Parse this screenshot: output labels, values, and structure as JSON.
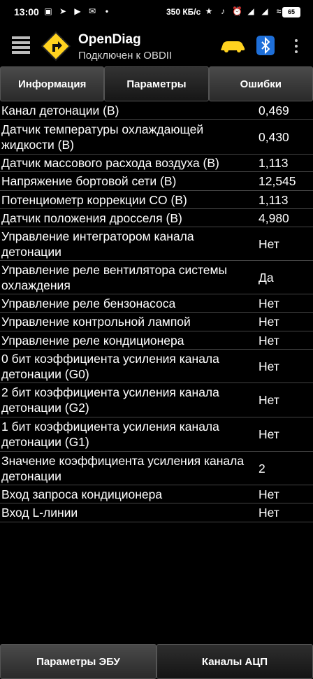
{
  "status_bar": {
    "time": "13:00",
    "speed": "350 КБ/с",
    "battery": "65",
    "left_icons": [
      "screenshot-icon",
      "telegram-icon",
      "video-icon",
      "mail-icon",
      "dot-icon"
    ],
    "right_icons": [
      "bluetooth-icon",
      "mute-icon",
      "alarm-icon",
      "signal-icon",
      "signal-icon",
      "wifi-icon"
    ]
  },
  "app_bar": {
    "title": "OpenDiag",
    "subtitle": "Подключен к OBDII",
    "car_color": "#ffd21f",
    "bt_color": "#1e6fd9"
  },
  "tabs": [
    {
      "label": "Информация"
    },
    {
      "label": "Параметры"
    },
    {
      "label": "Ошибки"
    }
  ],
  "active_tab": "Параметры",
  "params": [
    {
      "name": "Канал детонации (В)",
      "value": "0,469"
    },
    {
      "name": "Датчик температуры охлаждающей жидкости (В)",
      "value": "0,430"
    },
    {
      "name": "Датчик массового расхода воздуха (В)",
      "value": "1,113"
    },
    {
      "name": "Напряжение бортовой сети (В)",
      "value": "12,545"
    },
    {
      "name": "Потенциометр коррекции CO (В)",
      "value": "1,113"
    },
    {
      "name": "Датчик положения дросселя (В)",
      "value": "4,980"
    },
    {
      "name": "Управление интегратором канала детонации",
      "value": "Нет"
    },
    {
      "name": "Управление реле вентилятора системы охлаждения",
      "value": "Да"
    },
    {
      "name": "Управление реле бензонасоса",
      "value": "Нет"
    },
    {
      "name": "Управление контрольной лампой",
      "value": "Нет"
    },
    {
      "name": "Управление реле кондиционера",
      "value": "Нет"
    },
    {
      "name": "0 бит коэффициента усиления канала детонации (G0)",
      "value": "Нет"
    },
    {
      "name": "2 бит коэффициента усиления канала детонации (G2)",
      "value": "Нет"
    },
    {
      "name": "1 бит коэффициента усиления канала детонации (G1)",
      "value": "Нет"
    },
    {
      "name": "Значение коэффициента усиления канала детонации",
      "value": "2"
    },
    {
      "name": "Вход запроса кондиционера",
      "value": "Нет"
    },
    {
      "name": "Вход L-линии",
      "value": "Нет"
    }
  ],
  "bottom_tabs": [
    {
      "label": "Параметры ЭБУ"
    },
    {
      "label": "Каналы АЦП"
    }
  ],
  "active_bottom_tab": "Каналы АЦП"
}
